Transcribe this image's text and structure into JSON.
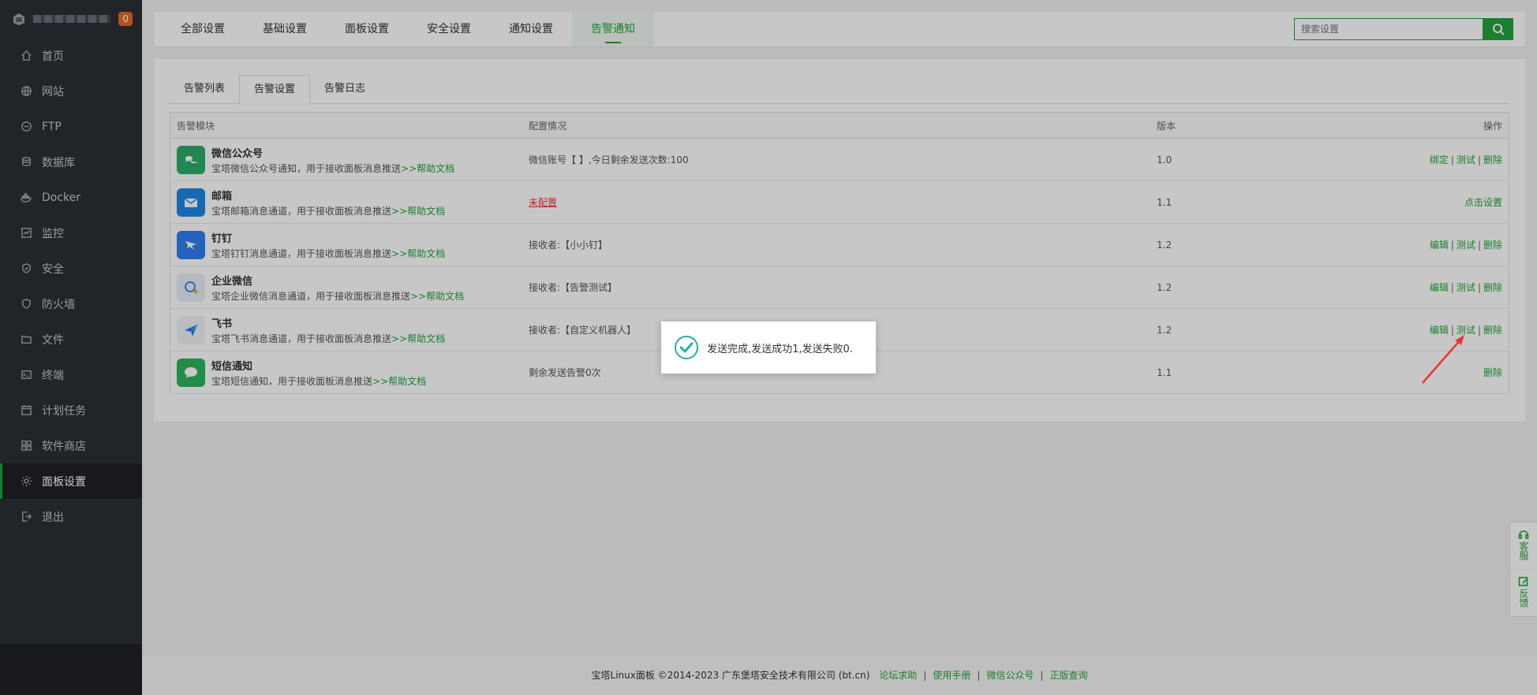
{
  "sidebar": {
    "badge": "0",
    "items": [
      {
        "label": "首页",
        "icon": "home-icon"
      },
      {
        "label": "网站",
        "icon": "globe-icon"
      },
      {
        "label": "FTP",
        "icon": "ftp-icon"
      },
      {
        "label": "数据库",
        "icon": "database-icon"
      },
      {
        "label": "Docker",
        "icon": "docker-icon"
      },
      {
        "label": "监控",
        "icon": "monitor-icon"
      },
      {
        "label": "安全",
        "icon": "shield-icon"
      },
      {
        "label": "防火墙",
        "icon": "firewall-icon"
      },
      {
        "label": "文件",
        "icon": "folder-icon"
      },
      {
        "label": "终端",
        "icon": "terminal-icon"
      },
      {
        "label": "计划任务",
        "icon": "calendar-icon"
      },
      {
        "label": "软件商店",
        "icon": "apps-icon"
      },
      {
        "label": "面板设置",
        "icon": "gear-icon",
        "active": true
      },
      {
        "label": "退出",
        "icon": "logout-icon"
      }
    ]
  },
  "topbar": {
    "tabs": [
      "全部设置",
      "基础设置",
      "面板设置",
      "安全设置",
      "通知设置",
      "告警通知"
    ],
    "active_tab": 5,
    "search_placeholder": "搜索设置"
  },
  "subtabs": [
    "告警列表",
    "告警设置",
    "告警日志"
  ],
  "table": {
    "headers": [
      "告警模块",
      "配置情况",
      "版本",
      "操作"
    ],
    "rows": [
      {
        "name": "微信公众号",
        "desc": "宝塔微信公众号通知，用于接收面板消息推送",
        "help": ">>帮助文档",
        "config": "微信账号【  】,今日剩余发送次数:100",
        "version": "1.0",
        "actions": [
          "绑定",
          "测试",
          "删除"
        ],
        "color": "#2aae67"
      },
      {
        "name": "邮箱",
        "desc": "宝塔邮箱消息通道，用于接收面板消息推送",
        "help": ">>帮助文档",
        "config": "未配置",
        "config_notset": true,
        "version": "1.1",
        "actions": [
          "点击设置"
        ],
        "color": "#1e88e5"
      },
      {
        "name": "钉钉",
        "desc": "宝塔钉钉消息通道，用于接收面板消息推送",
        "help": ">>帮助文档",
        "config": "接收者:【小小钉】",
        "version": "1.2",
        "actions": [
          "编辑",
          "测试",
          "删除"
        ],
        "color": "#2f7ff0"
      },
      {
        "name": "企业微信",
        "desc": "宝塔企业微信消息通道，用于接收面板消息推送",
        "help": ">>帮助文档",
        "config": "接收者:【告警测试】",
        "version": "1.2",
        "actions": [
          "编辑",
          "测试",
          "删除"
        ],
        "color": "#e8eef6"
      },
      {
        "name": "飞书",
        "desc": "宝塔飞书消息通道，用于接收面板消息推送",
        "help": ">>帮助文档",
        "config": "接收者:【自定义机器人】",
        "version": "1.2",
        "actions": [
          "编辑",
          "测试",
          "删除"
        ],
        "color": "#eef2f5"
      },
      {
        "name": "短信通知",
        "desc": "宝塔短信通知，用于接收面板消息推送",
        "help": ">>帮助文档",
        "config": "剩余发送告警0次",
        "version": "1.1",
        "actions": [
          "删除"
        ],
        "color": "#2bb55a"
      }
    ]
  },
  "toast": {
    "message": "发送完成,发送成功1,发送失败0."
  },
  "footer": {
    "text": "宝塔Linux面板 ©2014-2023 广东堡塔安全技术有限公司 (bt.cn)",
    "links": [
      "论坛求助",
      "使用手册",
      "微信公众号",
      "正版查询"
    ]
  },
  "float": {
    "service": "客服",
    "feedback": "反馈"
  },
  "colors": {
    "accent": "#20a53a",
    "sidebar_bg": "#2b2f35",
    "danger": "#e53935"
  }
}
